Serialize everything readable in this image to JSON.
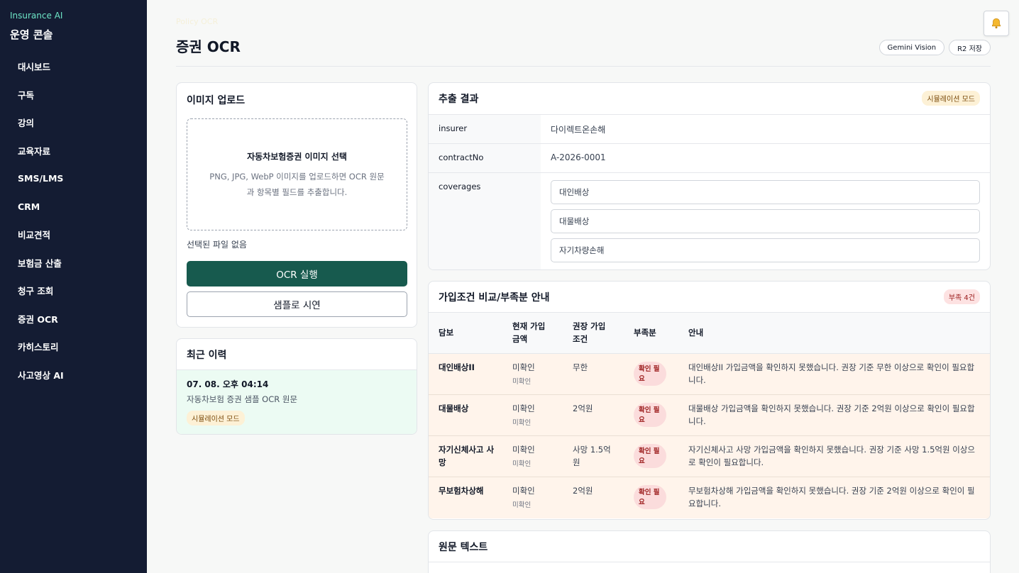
{
  "sidebar": {
    "brand_small": "Insurance AI",
    "brand_title": "운영 콘솔",
    "items": [
      {
        "label": "대시보드"
      },
      {
        "label": "구독"
      },
      {
        "label": "강의"
      },
      {
        "label": "교육자료"
      },
      {
        "label": "SMS/LMS"
      },
      {
        "label": "CRM"
      },
      {
        "label": "비교견적"
      },
      {
        "label": "보험금 산출"
      },
      {
        "label": "청구 조회"
      },
      {
        "label": "증권 OCR"
      },
      {
        "label": "카히스토리"
      },
      {
        "label": "사고영상 AI"
      }
    ]
  },
  "header": {
    "faint_label": "Policy OCR",
    "title": "증권 OCR",
    "pills": [
      "Gemini Vision",
      "R2 저장"
    ],
    "bell_icon": "bell-icon"
  },
  "upload": {
    "title": "이미지 업로드",
    "dz_title": "자동차보험증권 이미지 선택",
    "dz_desc": "PNG, JPG, WebP 이미지를 업로드하면 OCR 원문과 항목별 필드를 추출합니다.",
    "no_file": "선택된 파일 없음",
    "run_button": "OCR 실행",
    "sample_button": "샘플로 시연"
  },
  "history": {
    "title": "최근 이력",
    "items": [
      {
        "time": "07. 08. 오후 04:14",
        "text": "자동차보험 증권 샘플 OCR 원문",
        "badge": "시뮬레이션 모드"
      }
    ]
  },
  "result": {
    "title": "추출 결과",
    "badge": "시뮬레이션 모드",
    "rows": [
      {
        "key": "insurer",
        "value": "다이렉트온손해"
      },
      {
        "key": "contractNo",
        "value": "A-2026-0001"
      }
    ],
    "coverages_key": "coverages",
    "coverages": [
      "대인배상",
      "대물배상",
      "자기차량손해"
    ]
  },
  "compare": {
    "title": "가입조건 비교/부족분 안내",
    "badge": "부족 4건",
    "headers": {
      "coverage": "담보",
      "current": "현재 가입\n금액",
      "recommended": "권장 가입\n조건",
      "shortfall": "부족분",
      "guide": "안내"
    },
    "rows": [
      {
        "name": "대인배상II",
        "current": "미확인",
        "current_sub": "미확인",
        "recommended": "무한",
        "status": "확인 필요",
        "guide": "대인배상II 가입금액을 확인하지 못했습니다. 권장 기준 무한 이상으로 확인이 필요합니다."
      },
      {
        "name": "대물배상",
        "current": "미확인",
        "current_sub": "미확인",
        "recommended": "2억원",
        "status": "확인 필요",
        "guide": "대물배상 가입금액을 확인하지 못했습니다. 권장 기준 2억원 이상으로 확인이 필요합니다."
      },
      {
        "name": "자기신체사고 사망",
        "current": "미확인",
        "current_sub": "미확인",
        "recommended": "사망 1.5억원",
        "status": "확인 필요",
        "guide": "자기신체사고 사망 가입금액을 확인하지 못했습니다. 권장 기준 사망 1.5억원 이상으로 확인이 필요합니다."
      },
      {
        "name": "무보험차상해",
        "current": "미확인",
        "current_sub": "미확인",
        "recommended": "2억원",
        "status": "확인 필요",
        "guide": "무보험차상해 가입금액을 확인하지 못했습니다. 권장 기준 2억원 이상으로 확인이 필요합니다."
      }
    ]
  },
  "raw": {
    "title": "원문 텍스트"
  },
  "colors": {
    "sidebar_bg": "#141c33",
    "accent": "#175a4e",
    "brand_accent": "#6ee7c8",
    "row_warn": "#fff4eb",
    "history_active": "#ecfbf3"
  }
}
